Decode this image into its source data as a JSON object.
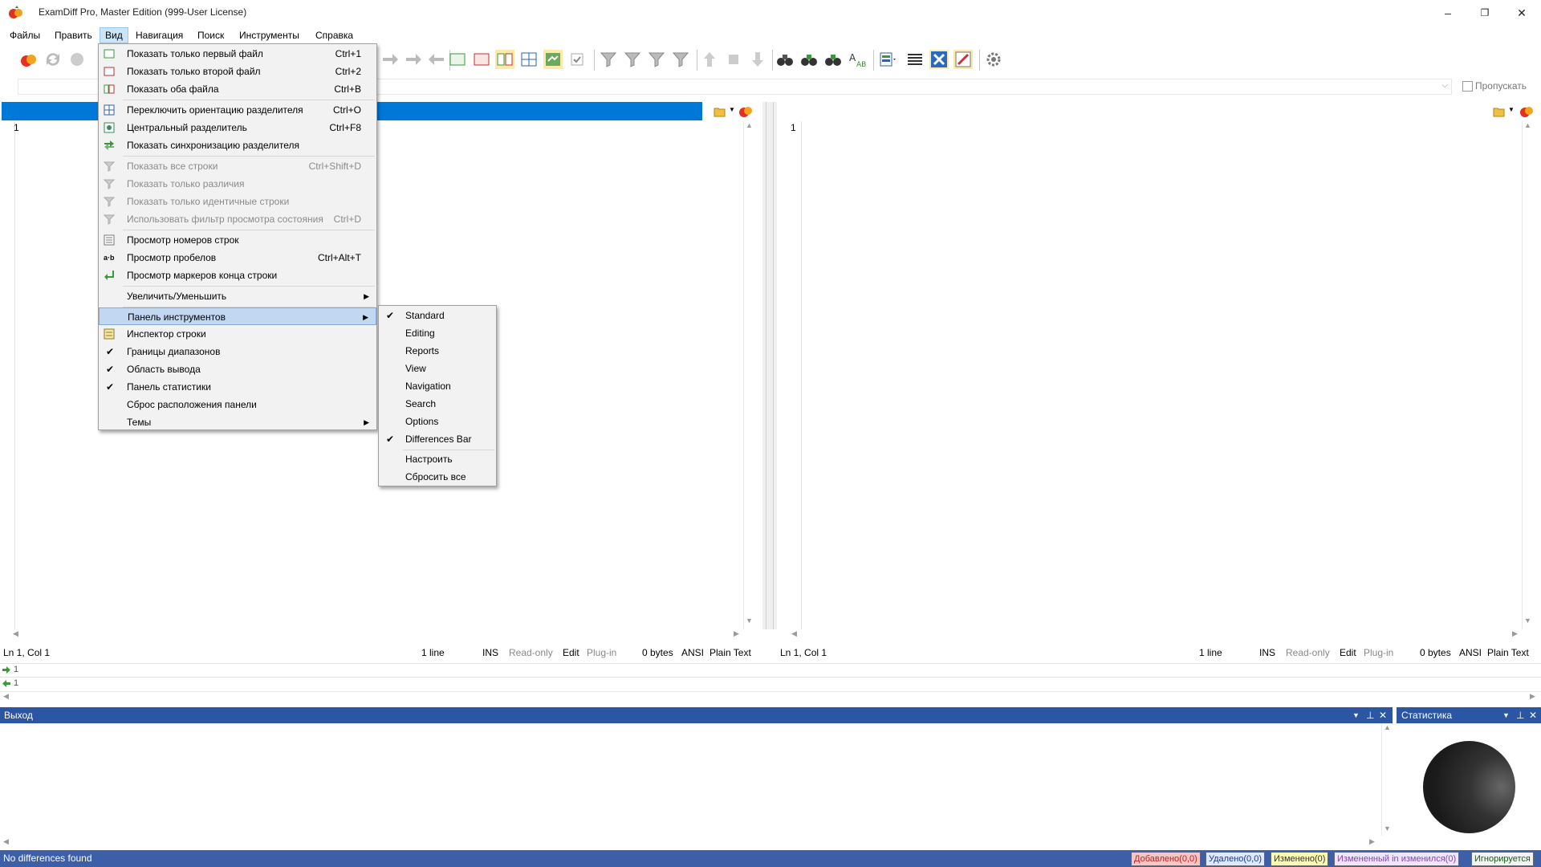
{
  "window": {
    "title": "ExamDiff Pro, Master Edition (999-User License)",
    "minimize": "–",
    "restore": "❐",
    "close": "✕"
  },
  "menubar": [
    {
      "label": "Файлы"
    },
    {
      "label": "Править"
    },
    {
      "label": "Вид"
    },
    {
      "label": "Навигация"
    },
    {
      "label": "Поиск"
    },
    {
      "label": "Инструменты"
    },
    {
      "label": "Справка"
    }
  ],
  "address": {
    "skip_label": "Пропускать"
  },
  "view_menu": {
    "items": [
      {
        "label": "Показать только первый файл",
        "shortcut": "Ctrl+1",
        "icon": "first-file-icon"
      },
      {
        "label": "Показать только второй файл",
        "shortcut": "Ctrl+2",
        "icon": "second-file-icon"
      },
      {
        "label": "Показать оба файла",
        "shortcut": "Ctrl+B",
        "icon": "both-files-icon"
      },
      {
        "label": "Переключить ориентацию разделителя",
        "shortcut": "Ctrl+O",
        "icon": "split-orientation-icon"
      },
      {
        "label": "Центральный разделитель",
        "shortcut": "Ctrl+F8",
        "icon": "center-splitter-icon"
      },
      {
        "label": "Показать синхронизацию разделителя",
        "shortcut": "",
        "icon": "sync-splitter-icon"
      },
      {
        "label": "Показать все строки",
        "shortcut": "Ctrl+Shift+D",
        "icon": "filter-icon"
      },
      {
        "label": "Показать только различия",
        "shortcut": "",
        "icon": "filter-diff-icon"
      },
      {
        "label": "Показать только идентичные строки",
        "shortcut": "",
        "icon": "filter-identical-icon"
      },
      {
        "label": "Использовать фильтр просмотра состояния",
        "shortcut": "Ctrl+D",
        "icon": "filter-state-icon"
      },
      {
        "label": "Просмотр номеров строк",
        "shortcut": "",
        "icon": "line-numbers-icon"
      },
      {
        "label": "Просмотр пробелов",
        "shortcut": "Ctrl+Alt+T",
        "icon": "whitespace-icon",
        "icon_text": "a·b"
      },
      {
        "label": "Просмотр маркеров конца строки",
        "shortcut": "",
        "icon": "eol-marker-icon"
      },
      {
        "label": "Увеличить/Уменьшить",
        "shortcut": "",
        "arrow": "▶"
      },
      {
        "label": "Панель инструментов",
        "shortcut": "",
        "arrow": "▶"
      },
      {
        "label": "Инспектор строки",
        "shortcut": "",
        "icon": "line-inspector-icon"
      },
      {
        "label": "Границы диапазонов",
        "shortcut": "",
        "checked": "✔"
      },
      {
        "label": "Область вывода",
        "shortcut": "",
        "checked": "✔"
      },
      {
        "label": "Панель статистики",
        "shortcut": "",
        "checked": "✔"
      },
      {
        "label": "Сброс расположения панели",
        "shortcut": ""
      },
      {
        "label": "Темы",
        "shortcut": "",
        "arrow": "▶"
      }
    ]
  },
  "toolbar_submenu": {
    "items": [
      {
        "label": "Standard",
        "checked": "✔"
      },
      {
        "label": "Editing"
      },
      {
        "label": "Reports"
      },
      {
        "label": "View"
      },
      {
        "label": "Navigation"
      },
      {
        "label": "Search"
      },
      {
        "label": "Options"
      },
      {
        "label": "Differences Bar",
        "checked": "✔"
      },
      {
        "label": "Настроить"
      },
      {
        "label": "Сбросить все"
      }
    ]
  },
  "left_pane": {
    "line_number": "1",
    "status": {
      "pos": "Ln 1, Col 1",
      "lines": "1 line",
      "ins": "INS",
      "readonly": "Read-only",
      "edit": "Edit",
      "plugin": "Plug-in",
      "bytes": "0 bytes",
      "enc": "ANSI",
      "type": "Plain Text"
    }
  },
  "right_pane": {
    "line_number": "1",
    "status": {
      "pos": "Ln 1, Col 1",
      "lines": "1 line",
      "ins": "INS",
      "readonly": "Read-only",
      "edit": "Edit",
      "plugin": "Plug-in",
      "bytes": "0 bytes",
      "enc": "ANSI",
      "type": "Plain Text"
    }
  },
  "diff_lines": [
    "1",
    "1"
  ],
  "output_panel": {
    "title": "Выход"
  },
  "stats_panel": {
    "title": "Статистика"
  },
  "bottom_status": {
    "message": "No differences found",
    "added": "Добавлено(0,0)",
    "deleted": "Удалено(0,0)",
    "changed": "Изменено(0)",
    "changed_in_changed": "Измененный in изменился(0)",
    "ignored": "Игнорируется"
  },
  "colors": {
    "header_blue": "#0078d7",
    "panel_blue": "#2a56a4",
    "added_bg": "#f5c6c6",
    "deleted_bg": "#cfe0ff",
    "changed_bg": "#fffbb0",
    "changed_in_bg": "#e0d0ff"
  }
}
